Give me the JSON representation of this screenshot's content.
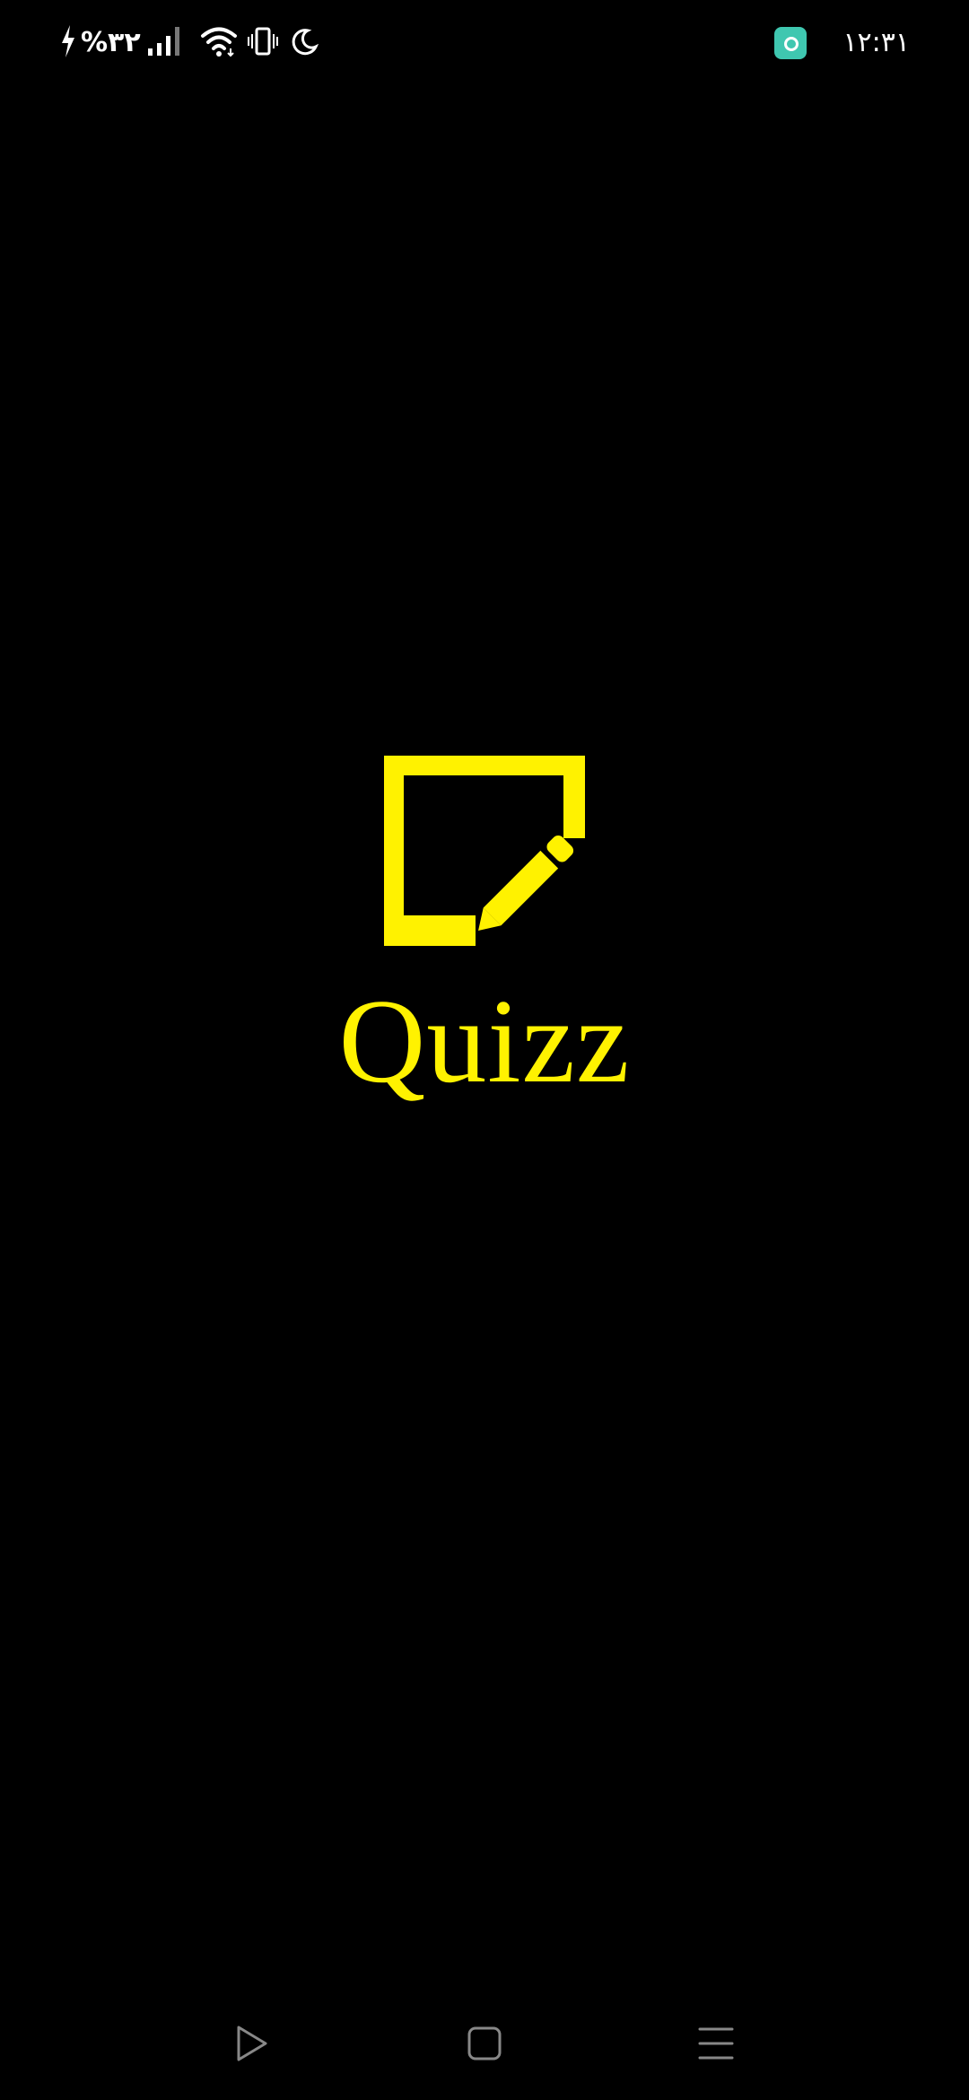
{
  "status_bar": {
    "battery_text": "%۳۲",
    "clock": "۱۲:۳۱",
    "icons": [
      "charging-icon",
      "signal-icon",
      "wifi-icon",
      "vibrate-icon",
      "do-not-disturb-moon-icon",
      "app-notification-icon"
    ]
  },
  "splash": {
    "app_name": "Quizz",
    "logo_icon": "note-edit-icon",
    "accent_color": "#fff200",
    "background_color": "#000000"
  },
  "nav_bar": {
    "buttons": [
      "back-triangle-icon",
      "home-square-icon",
      "recents-menu-icon"
    ]
  }
}
